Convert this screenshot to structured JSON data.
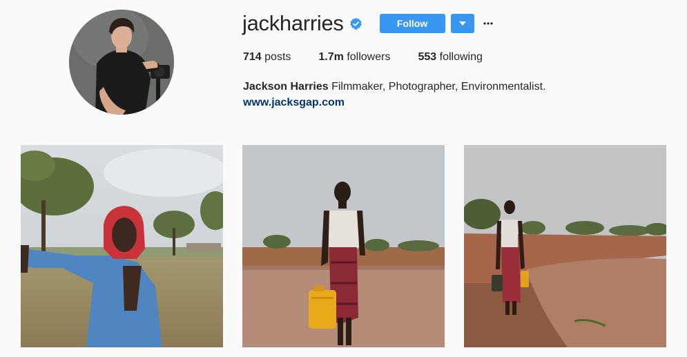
{
  "profile": {
    "username": "jackharries",
    "verified": true,
    "follow_label": "Follow",
    "more_icon": "ellipsis-icon",
    "dropdown_icon": "caret-down-icon"
  },
  "stats": {
    "posts_count": "714",
    "posts_label": "posts",
    "followers_count": "1.7m",
    "followers_label": "followers",
    "following_count": "553",
    "following_label": "following"
  },
  "bio": {
    "full_name": "Jackson Harries",
    "description": "Filmmaker, Photographer, Environmentalist.",
    "website": "www.jacksgap.com"
  },
  "colors": {
    "accent": "#3897f0",
    "link": "#003569",
    "background": "#fafafa",
    "text": "#262626"
  },
  "posts": [
    {
      "subject": "man-in-red-headscarf-blue-shirt"
    },
    {
      "subject": "boy-carrying-yellow-jerrycan-in-water"
    },
    {
      "subject": "man-with-jerrycans-at-water-edge"
    }
  ]
}
